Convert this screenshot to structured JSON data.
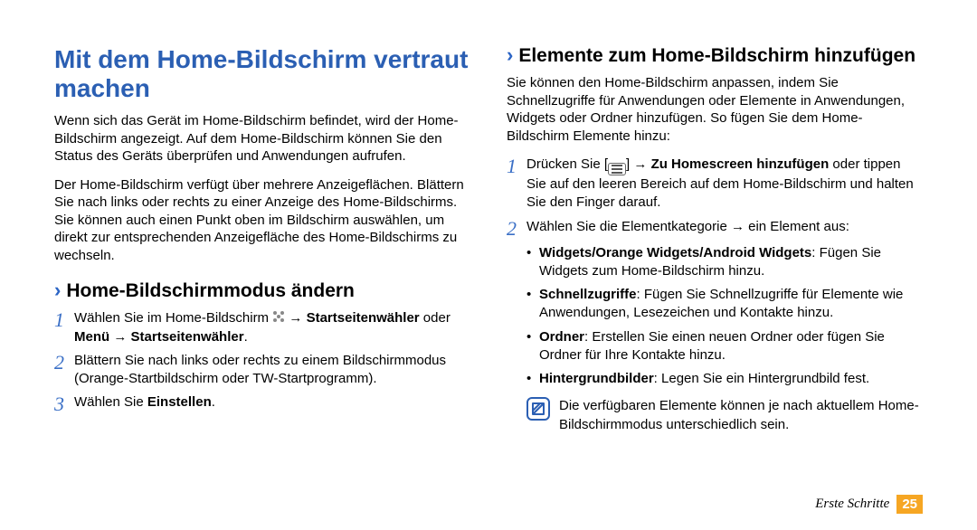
{
  "left": {
    "title": "Mit dem Home-Bildschirm vertraut machen",
    "para1": "Wenn sich das Gerät im Home-Bildschirm befindet, wird der Home-Bildschirm angezeigt. Auf dem Home-Bildschirm können Sie den Status des Geräts überprüfen und Anwendungen aufrufen.",
    "para2": "Der Home-Bildschirm verfügt über mehrere Anzeigeflächen. Blättern Sie nach links oder rechts zu einer Anzeige des Home-Bildschirms. Sie können auch einen Punkt oben im Bildschirm auswählen, um direkt zur entsprechenden Anzeigefläche des Home-Bildschirms zu wechseln.",
    "sub1": "Home-Bildschirmmodus ändern",
    "step1_a": "Wählen Sie im Home-Bildschirm ",
    "step1_b": " → ",
    "step1_c": "Startseitenwähler",
    "step1_d": " oder ",
    "step1_e": "Menü",
    "step1_f": " → ",
    "step1_g": "Startseitenwähler",
    "step1_h": ".",
    "step2": "Blättern Sie nach links oder rechts zu einem Bildschirmmodus (Orange-Startbildschirm oder TW-Startprogramm).",
    "step3_a": "Wählen Sie ",
    "step3_b": "Einstellen",
    "step3_c": "."
  },
  "right": {
    "sub1": "Elemente zum Home-Bildschirm hinzufügen",
    "para1": "Sie können den Home-Bildschirm anpassen, indem Sie Schnellzugriffe für Anwendungen oder Elemente in Anwendungen, Widgets oder Ordner hinzufügen. So fügen Sie dem Home-Bildschirm Elemente hinzu:",
    "step1_a": "Drücken Sie [",
    "step1_b": "] → ",
    "step1_c": "Zu Homescreen hinzufügen",
    "step1_d": " oder tippen Sie auf den leeren Bereich auf dem Home-Bildschirm und halten Sie den Finger darauf.",
    "step2": "Wählen Sie die Elementkategorie → ein Element aus:",
    "bullets": {
      "b1_a": "Widgets/Orange Widgets/Android Widgets",
      "b1_b": ": Fügen Sie Widgets zum Home-Bildschirm hinzu.",
      "b2_a": "Schnellzugriffe",
      "b2_b": ": Fügen Sie Schnellzugriffe für Elemente wie Anwendungen, Lesezeichen und Kontakte hinzu.",
      "b3_a": "Ordner",
      "b3_b": ": Erstellen Sie einen neuen Ordner oder fügen Sie Ordner für Ihre Kontakte hinzu.",
      "b4_a": "Hintergrundbilder",
      "b4_b": ": Legen Sie ein Hintergrundbild fest."
    },
    "note": "Die verfügbaren Elemente können je nach aktuellem Home-Bildschirmmodus unterschiedlich sein."
  },
  "footer": {
    "section": "Erste Schritte",
    "page": "25"
  }
}
